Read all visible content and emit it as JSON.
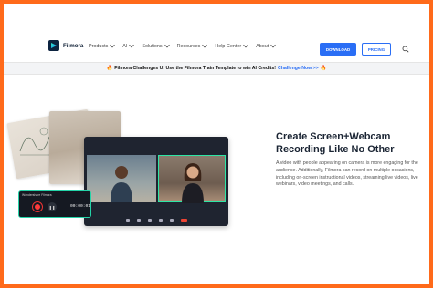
{
  "header": {
    "logo_text": "Filmora",
    "nav": [
      {
        "label": "Products"
      },
      {
        "label": "AI"
      },
      {
        "label": "Solutions"
      },
      {
        "label": "Resources"
      },
      {
        "label": "Help Center"
      },
      {
        "label": "About"
      }
    ],
    "download_label": "DOWNLOAD",
    "pricing_label": "PRICING"
  },
  "banner": {
    "text": "Filmora Challenges U: Use the Filmora Train Template to win AI Credits!",
    "link": "Challenge Now >>"
  },
  "hero": {
    "title": "Create Screen+Webcam Recording Like No Other",
    "body": "A video with people appearing on camera is more engaging for the audience. Additionally, Filmora can record on multiple occasions, including on-screen instructional videos, streaming live videos, live webinars, video meetings, and calls."
  },
  "recorder": {
    "title": "Wondershare Filmora",
    "time": "00:00:01"
  },
  "colors": {
    "accent": "#2a6ef5",
    "frame": "#ff6a1a",
    "recorder_border": "#24d3a8"
  }
}
